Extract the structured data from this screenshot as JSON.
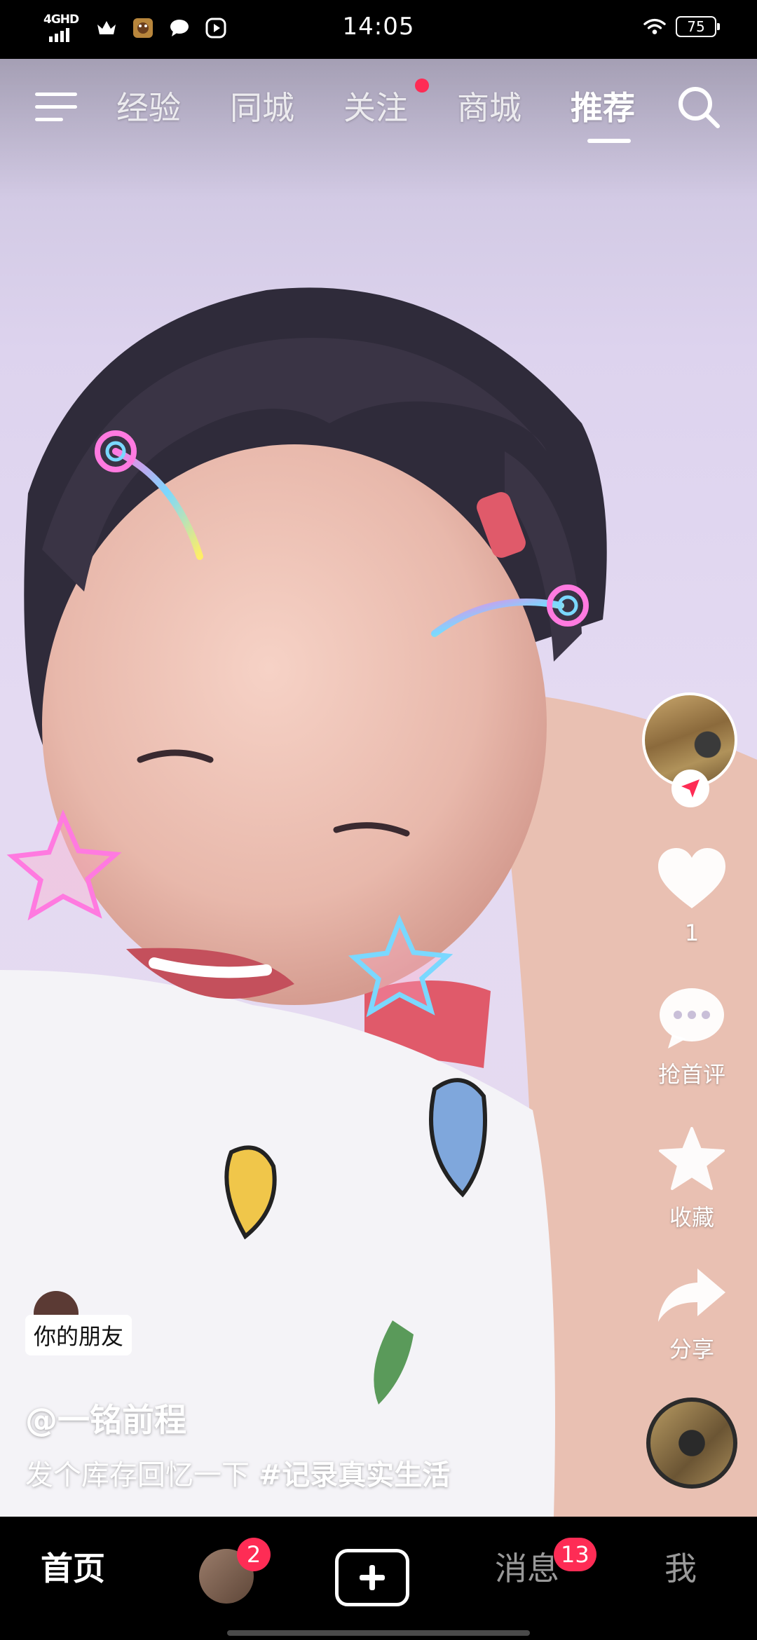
{
  "status_bar": {
    "network": "4GHD",
    "time": "14:05",
    "battery": "75",
    "left_icons": [
      "signal-icon",
      "crown-icon",
      "game-app-icon",
      "chat-bubble-icon",
      "play-icon"
    ],
    "right_icons": [
      "wifi-icon",
      "battery-icon"
    ]
  },
  "top_nav": {
    "menu_icon": "menu-icon",
    "tabs": [
      {
        "label": "经验",
        "active": false
      },
      {
        "label": "同城",
        "active": false
      },
      {
        "label": "关注",
        "active": false,
        "has_dot": true
      },
      {
        "label": "商城",
        "active": false
      },
      {
        "label": "推荐",
        "active": true
      }
    ],
    "search_icon": "search-icon"
  },
  "side_actions": {
    "like_count": "1",
    "comment_label": "抢首评",
    "favorite_label": "收藏",
    "share_label": "分享"
  },
  "caption": {
    "tag": "你的朋友",
    "author": "@一铭前程",
    "text": "发个库存回忆一下",
    "hashtag": "#记录真实生活"
  },
  "bottom_nav": {
    "home": "首页",
    "friends_badge": "2",
    "messages": "消息",
    "messages_badge": "13",
    "me": "我"
  },
  "colors": {
    "accent": "#fe2c55",
    "background": "#000000",
    "video_bg": "#e4daf2"
  }
}
